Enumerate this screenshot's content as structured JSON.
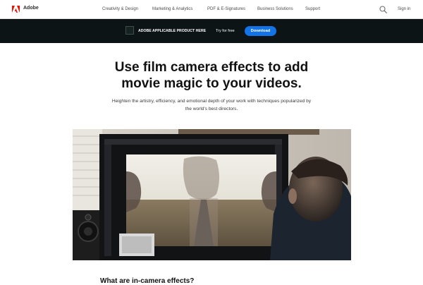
{
  "nav": {
    "brand": "Adobe",
    "items": [
      {
        "label": "Creativity & Design"
      },
      {
        "label": "Marketing & Analytics"
      },
      {
        "label": "PDF & E-Signatures"
      },
      {
        "label": "Business Solutions"
      },
      {
        "label": "Support"
      }
    ],
    "signin": "Sign in",
    "brand_color": "#eb1000"
  },
  "promo": {
    "product_name": "ADOBE APPLICABLE PRODUCT HERE",
    "try_label": "Try for free",
    "download_label": "Download",
    "accent_color": "#1473e6",
    "background_color": "#0c1416"
  },
  "hero": {
    "headline_line1": "Use film camera effects to add",
    "headline_line2": "movie magic to your videos.",
    "subtext_line1": "Heighten the artistry, efficiency, and emotional depth of your work with techniques popularized by",
    "subtext_line2": "the world's best directors."
  },
  "section": {
    "heading": "What are in-camera effects?"
  },
  "icons": {
    "logo": "adobe-logo-icon",
    "search": "search-icon"
  }
}
